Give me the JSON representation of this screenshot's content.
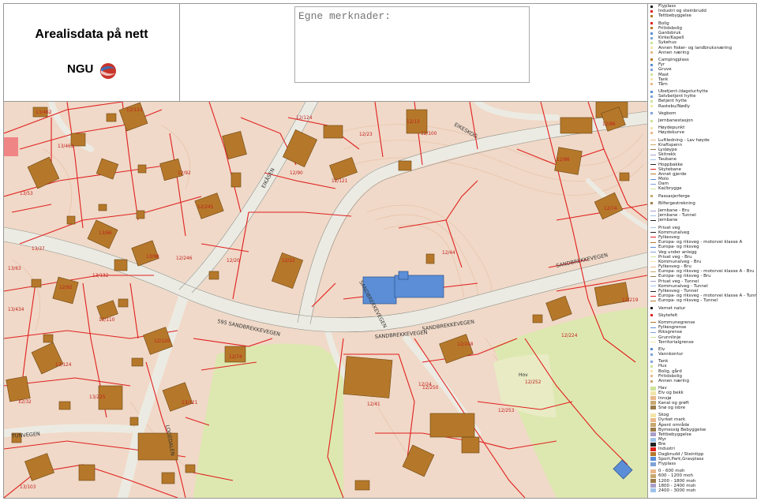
{
  "header": {
    "title": "Arealisdata på nett",
    "org": "NGU"
  },
  "notes": {
    "placeholder": "Egne merknader:"
  },
  "map": {
    "road_names": [
      "SANDBREKKEVEGEN",
      "SANDBREKKEVEGEN",
      "SANDBREKKEVEGEN",
      "595 SANDBREKKEVEGEN",
      "SANDBREKKEVEGEN",
      "EIKESKOG",
      "TUNVEGEN",
      "EIKÅSEN",
      "LOGEDALEN"
    ],
    "parcel_labels": [
      "13/462",
      "12/124",
      "13/463",
      "12/90",
      "12/121",
      "12/133",
      "12/100",
      "12/86",
      "12/13",
      "12/92",
      "13/53",
      "13/66",
      "13/98",
      "13/37",
      "12/245",
      "12/246",
      "12/20",
      "12/23",
      "12/22",
      "12/44",
      "13/63",
      "13/132",
      "12/92",
      "12/110",
      "12/120",
      "12/74",
      "12/248",
      "12/24",
      "12/41",
      "12/250",
      "12/252",
      "12/253",
      "12/224",
      "12/219",
      "13/434",
      "13/124",
      "13/225",
      "13/103",
      "13/121",
      "12/32",
      "12/74",
      "12/86"
    ],
    "fields": [
      "Hov"
    ]
  },
  "legend": {
    "sections": [
      [
        "Flyplass",
        "Industri og steinbrudd",
        "Tettbebyggelse"
      ],
      [
        "Bolig",
        "Fritidsbolig",
        "Gardsbruk",
        "Kirke/Kapell",
        "Sykehus",
        "Annen fisker- og landbruksnæring",
        "Annen næring"
      ],
      [
        "Campingplass",
        "Fyr",
        "Gruve",
        "Mast",
        "Tank",
        "Tårn"
      ],
      [
        "Ubetjent-/dagsturhytte",
        "Selvbetjent hytte",
        "Betjent hytte",
        "Rastebu/Nødly"
      ],
      [
        "Vegbom"
      ],
      [
        "Jernbanestasjon"
      ],
      [
        "Høydepunkt",
        "Høydekurve"
      ],
      [
        "Luftledning - Lav høyde",
        "Kraftspenn",
        "Lysløype",
        "Skitrekk",
        "Taubane",
        "Hoppbakke",
        "Skytebane",
        "Annet gjerde",
        "Molo",
        "Dam",
        "Kai/brygge"
      ],
      [
        "Passasjerferge"
      ],
      [
        "Bilfergestrekning"
      ],
      [
        "Jernbane - Bru",
        "Jernbane - Tunnel",
        "Jernbane"
      ],
      [
        "Privat veg",
        "Kommunalveg",
        "Fylkesveg",
        "Europa- og riksveg - motorvei klasse A",
        "Europa- og riksveg",
        "Veg under anlegg",
        "Privat veg - Bru",
        "Kommunalveg - Bru",
        "Fylkesveg - Bru",
        "Europa- og riksveg - motorvei klasse A - Bru",
        "Europa- og riksveg - Bru",
        "Privat veg - Tunnel",
        "Kommunalveg - Tunnel",
        "Fylkesveg - Tunnel",
        "Europa- og riksveg - motorvei klasse A - Tunnel",
        "Europa- og riksveg - Tunnel"
      ],
      [
        "Vernet natur"
      ],
      [
        "Skytefelt"
      ],
      [
        "Kommunegrense",
        "Fylkesgrense",
        "Riksgrense",
        "Grunnlinje",
        "Territorialgrense"
      ],
      [
        "Elv",
        "Vannkontur"
      ],
      [
        "Tank",
        "Hus",
        "Bolig, gård",
        "Fritidsbolig",
        "Annen næring"
      ],
      [
        "Hav",
        "Elv og bekk",
        "Innsjø",
        "Kanal og grøft",
        "Snø og isbre"
      ],
      [
        "Skog",
        "Dyrket mark",
        "Åpent område",
        "Bymessig Bebyggelse",
        "Tettbebyggelse",
        "Myr",
        "Bre",
        "Industri",
        "Dagbrudd / Steintipp",
        "Sport,Park,Gravplass",
        "Flyplass"
      ],
      [
        "0 - 600 moh",
        "600 - 1200 moh",
        "1200 - 1800 moh",
        "1800 - 2400 moh",
        "2400 - 3000 moh"
      ]
    ]
  },
  "colors": {
    "terrain": "#f0d9c8",
    "road": "#ecebe3",
    "parcel_line": "#e0201e",
    "building": "#b5782a",
    "public_building": "#5b8ed6",
    "forest": "#dde8b0"
  }
}
